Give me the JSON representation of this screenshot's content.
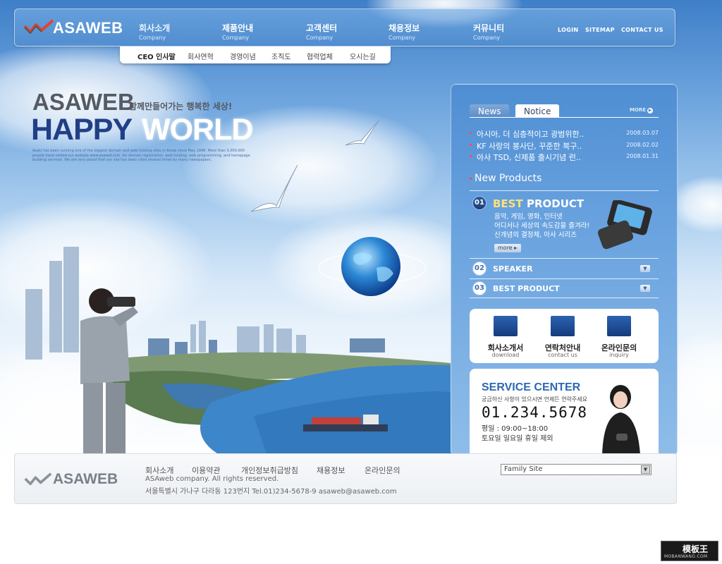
{
  "header": {
    "logo": "ASAWEB",
    "nav": [
      {
        "ko": "회사소개",
        "en": "Company"
      },
      {
        "ko": "제품안내",
        "en": "Company"
      },
      {
        "ko": "고객센터",
        "en": "Company"
      },
      {
        "ko": "채용정보",
        "en": "Company"
      },
      {
        "ko": "커뮤니티",
        "en": "Company"
      }
    ],
    "util": [
      "LOGIN",
      "SITEMAP",
      "CONTACT US"
    ]
  },
  "submenu": [
    "CEO 인사말",
    "회사연혁",
    "경영이념",
    "조직도",
    "협력업체",
    "오시는길"
  ],
  "hero": {
    "brand": "ASAWEB",
    "slogan": "함께만들어가는 행복한 세상!",
    "headline_1": "HAPPY",
    "headline_2": "WORLD",
    "body": "Asaki has been running one of the biggest domain and web hosting sites in Korea since May 1998. More than 3,000,000 people have visited our website www.asawaf.com, for domain registration, web hosting, web programming, and homepage building services. We are very proud that our site has been cited several times by many newspapers."
  },
  "news": {
    "tabs": [
      "News",
      "Notice"
    ],
    "more": "MORE",
    "items": [
      {
        "title": "아시아, 더 심층적이고 광범위한..",
        "date": "2008.03.07"
      },
      {
        "title": "KF 사랑의 봉사단, 꾸준한 복구..",
        "date": "2008.02.02"
      },
      {
        "title": "아사 TSD, 신제품 출시기념 런..",
        "date": "2008.01.31"
      }
    ]
  },
  "products": {
    "title": "New Products",
    "best": {
      "num": "01",
      "head_a": "BEST",
      "head_b": "PRODUCT",
      "lines": [
        "음악, 게임, 영화, 인터넷",
        "어디서나 세상의 속도감을 즐겨라!",
        "신개념의 결정체, 아사 시리즈"
      ],
      "more": "more"
    },
    "list": [
      {
        "num": "02",
        "label": "SPEAKER"
      },
      {
        "num": "03",
        "label": "BEST PRODUCT"
      }
    ]
  },
  "quick": [
    {
      "label": "회사소개서",
      "sub": "download"
    },
    {
      "label": "연락처안내",
      "sub": "contact us"
    },
    {
      "label": "온라인문의",
      "sub": "inquiry"
    }
  ],
  "service": {
    "title": "SERVICE CENTER",
    "desc": "궁금하신 사항이 있으시면 언제든 연락주세요",
    "phone": "01.234.5678",
    "hours_1": "평일 : 09:00~18:00",
    "hours_2": "토요일 일요일 휴일 제외"
  },
  "footer": {
    "logo": "ASAWEB",
    "links": [
      "회사소개",
      "이용약관",
      "개인정보취급방침",
      "채용정보",
      "온라인문의"
    ],
    "copyright": "ASAweb company. All rights reserved.",
    "address": "서울특별시 가나구 다라동 123번지   Tel.01)234-5678-9   asaweb@asaweb.com",
    "family_site": "Family Site"
  },
  "watermark": {
    "title": "模板王",
    "url": "MOBANWANG.COM"
  },
  "colors": {
    "brand_blue": "#213f86",
    "panel_blue": "#4f8ed3",
    "accent_red": "#ff4f4f",
    "service_blue": "#2c68b3"
  }
}
